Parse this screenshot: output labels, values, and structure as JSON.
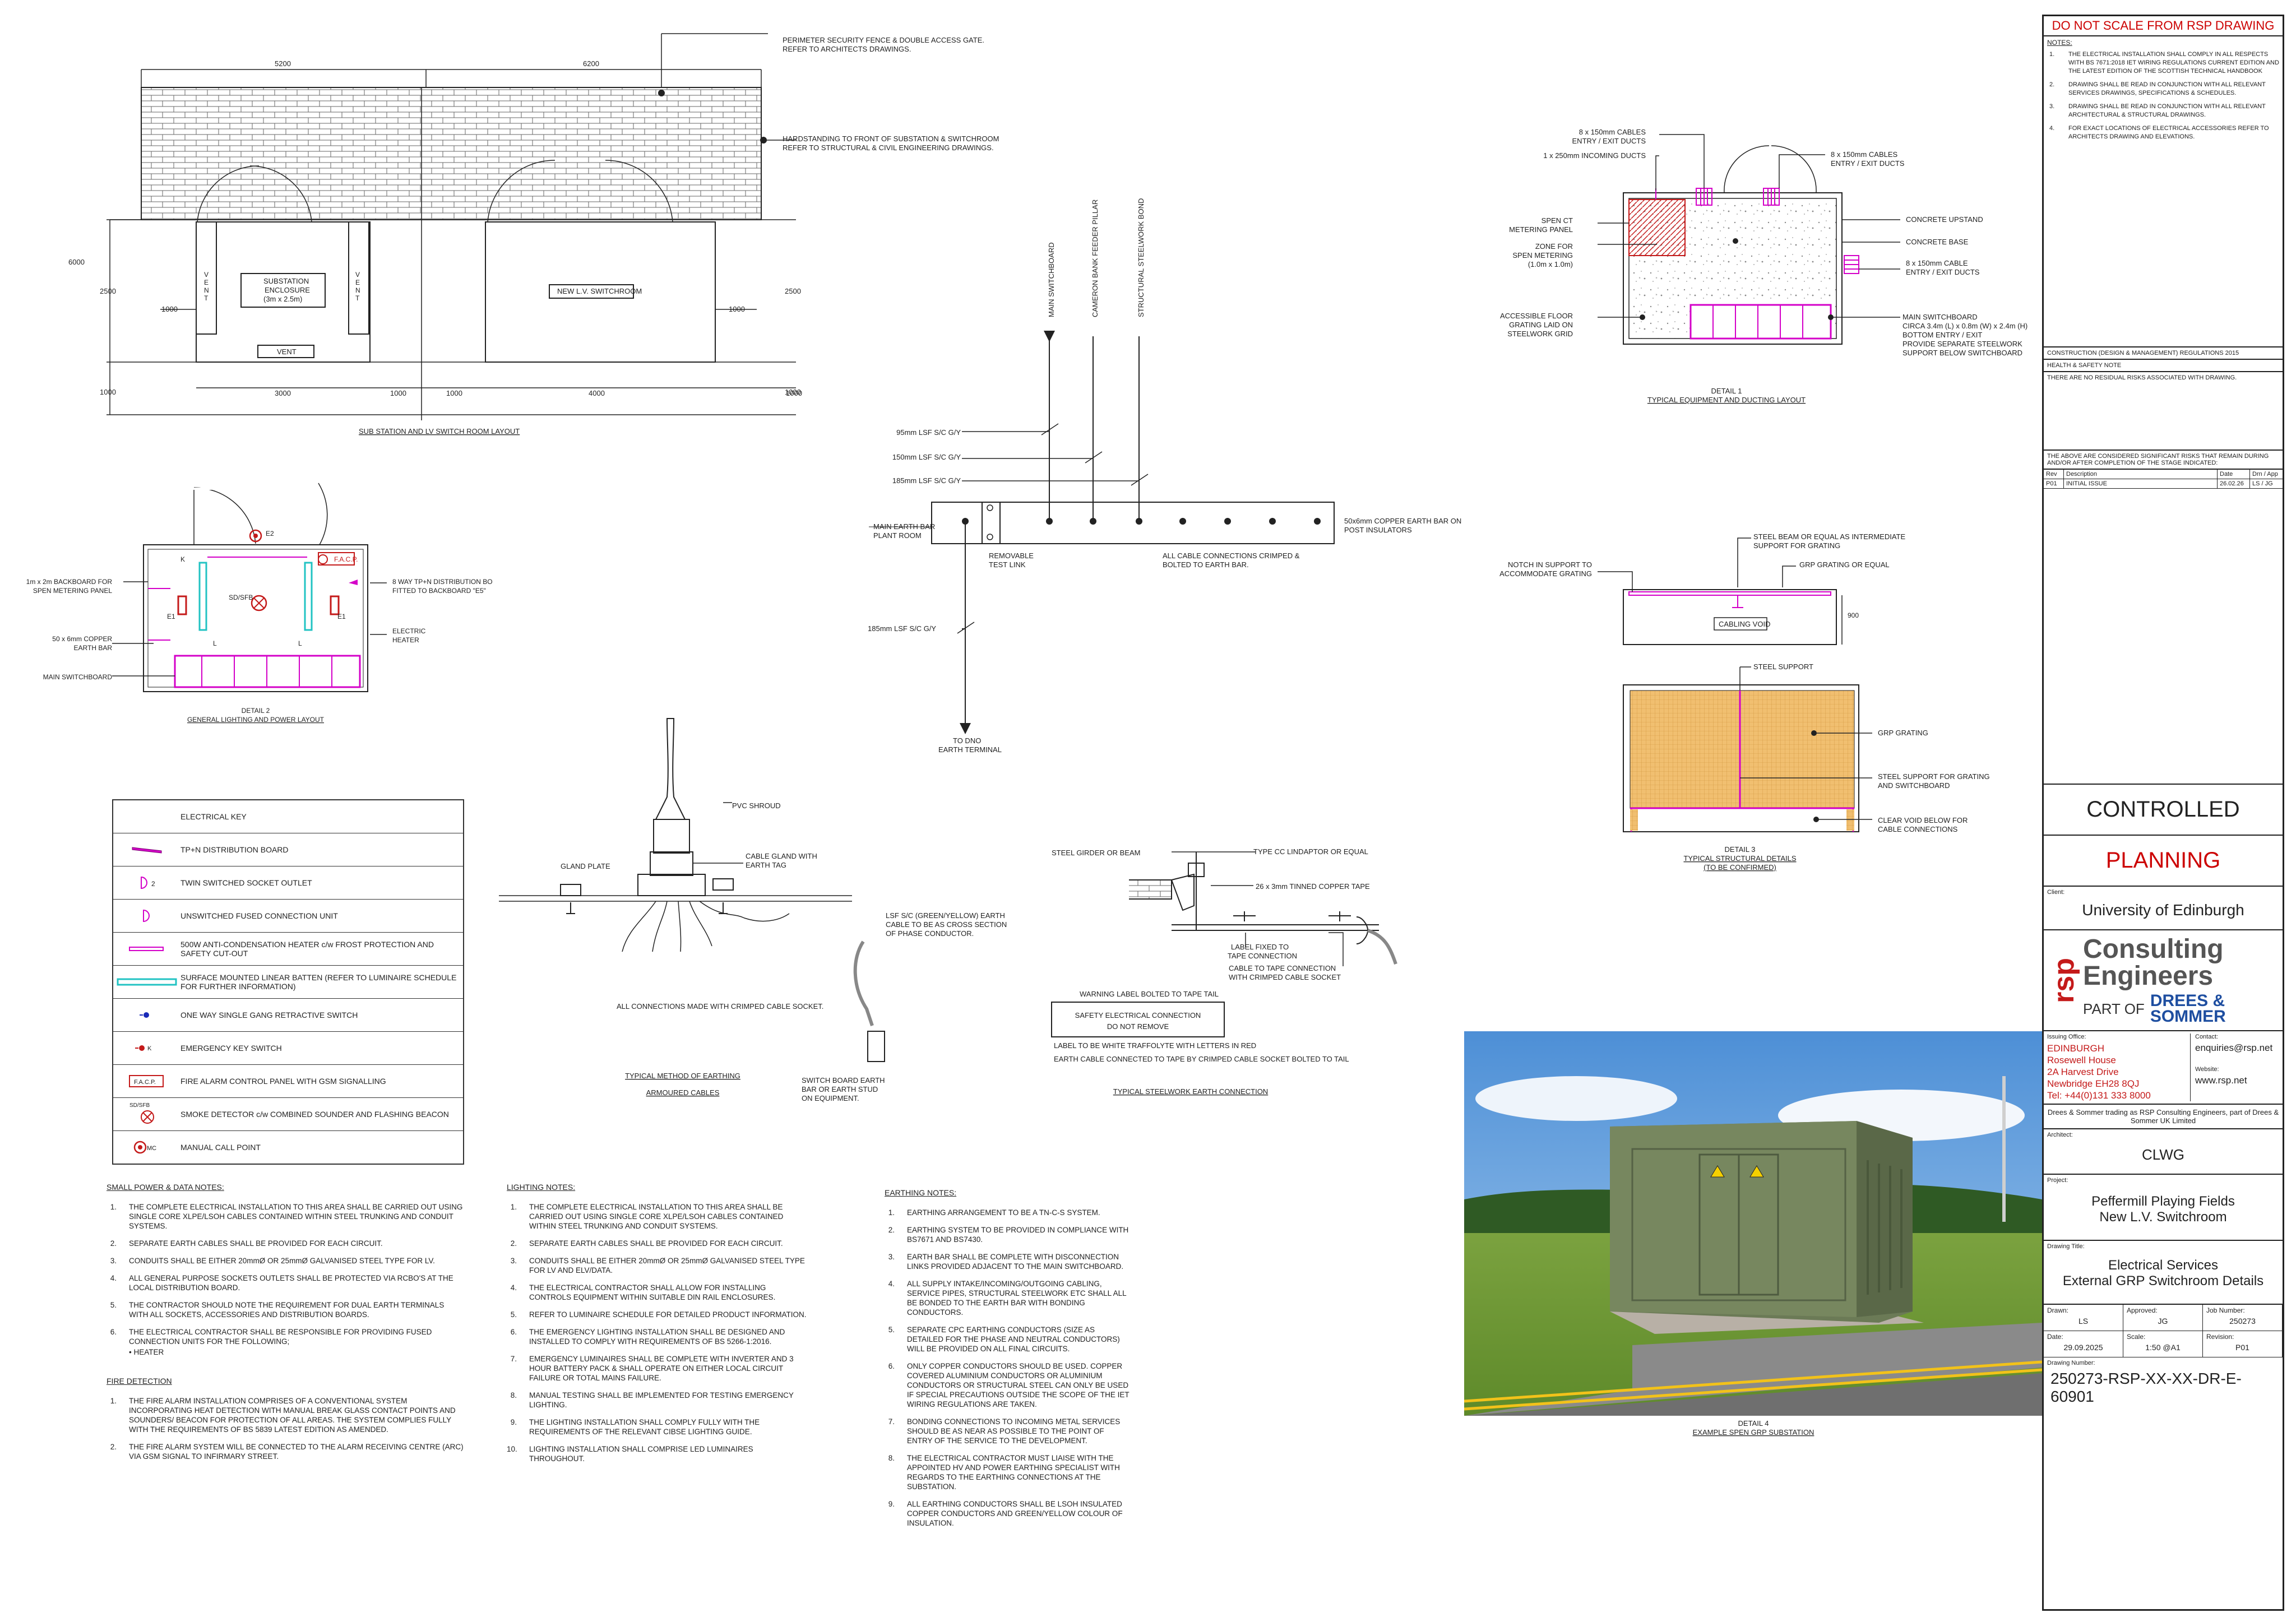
{
  "title_block": {
    "warning": "DO NOT SCALE FROM RSP DRAWING",
    "notes_label": "NOTES:",
    "notes": [
      {
        "n": "1.",
        "text": "THE ELECTRICAL INSTALLATION SHALL COMPLY IN ALL RESPECTS WITH BS 7671:2018 IET WIRING REGULATIONS CURRENT EDITION AND THE LATEST EDITION OF THE SCOTTISH TECHNICAL HANDBOOK"
      },
      {
        "n": "2.",
        "text": "DRAWING SHALL BE READ IN CONJUNCTION WITH ALL RELEVANT SERVICES DRAWINGS, SPECIFICATIONS & SCHEDULES."
      },
      {
        "n": "3.",
        "text": "DRAWING SHALL BE READ IN CONJUNCTION WITH ALL RELEVANT ARCHITECTURAL & STRUCTURAL DRAWINGS."
      },
      {
        "n": "4.",
        "text": "FOR EXACT LOCATIONS OF ELECTRICAL ACCESSORIES REFER TO ARCHITECTS DRAWING AND ELEVATIONS."
      }
    ],
    "cdm": "CONSTRUCTION (DESIGN & MANAGEMENT) REGULATIONS 2015",
    "hs_label": "HEALTH & SAFETY NOTE",
    "hs_text": "THERE ARE NO RESIDUAL RISKS ASSOCIATED WITH DRAWING.",
    "risks_text": "THE ABOVE ARE CONSIDERED SIGNIFICANT RISKS THAT REMAIN DURING AND/OR AFTER COMPLETION OF THE STAGE INDICATED:",
    "rev_headers": {
      "rev": "Rev",
      "desc": "Description",
      "date": "Date",
      "drn": "Drn / App"
    },
    "rev_row": {
      "rev": "P01",
      "desc": "INITIAL ISSUE",
      "date": "26.02.26",
      "drn": "LS / JG"
    },
    "status_1": "CONTROLLED",
    "status_2": "PLANNING",
    "client_label": "Client:",
    "client": "University of Edinburgh",
    "logo": {
      "rsp": "rsp",
      "line1": "Consulting",
      "line2": "Engineers",
      "part_of": "PART OF",
      "ds1": "DREES &",
      "ds2": "SOMMER"
    },
    "issuing_label": "Issuing Office:",
    "office": [
      "EDINBURGH",
      "Rosewell House",
      "2A Harvest Drive",
      "Newbridge EH28 8QJ",
      "Tel: +44(0)131 333 8000"
    ],
    "contact_label": "Contact:",
    "contact": "enquiries@rsp.net",
    "website_label": "Website:",
    "website": "www.rsp.net",
    "trading": "Drees & Sommer trading as RSP Consulting Engineers, part of Drees & Sommer UK Limited",
    "architect_label": "Architect:",
    "architect": "CLWG",
    "project_label": "Project:",
    "project_1": "Peffermill Playing Fields",
    "project_2": "New L.V. Switchroom",
    "drawing_title_label": "Drawing Title:",
    "drawing_title_1": "Electrical Services",
    "drawing_title_2": "External GRP Switchroom Details",
    "fields": [
      {
        "label": "Drawn:",
        "value": "LS"
      },
      {
        "label": "Approved:",
        "value": "JG"
      },
      {
        "label": "Job Number:",
        "value": "250273"
      },
      {
        "label": "Date:",
        "value": "29.09.2025"
      },
      {
        "label": "Scale:",
        "value": "1:50 @A1"
      },
      {
        "label": "Revision:",
        "value": "P01"
      }
    ],
    "drawing_number_label": "Drawing Number:",
    "drawing_number": "250273-RSP-XX-XX-DR-E-60901"
  },
  "layout_plan": {
    "dims": {
      "top_left": "5200",
      "top_right": "6200",
      "h_total": "6000",
      "h_mid_left": "2500",
      "h_mid_right": "2500",
      "h_bot_left": "1000",
      "h_bot_right": "1000",
      "w_1000a": "1000",
      "w_1000b": "1000",
      "b_3000": "3000",
      "b_1000a": "1000",
      "b_1000b": "1000",
      "b_4000": "4000",
      "b_1000c": "1000"
    },
    "fence_note_1": "PERIMETER SECURITY FENCE & DOUBLE ACCESS GATE.",
    "fence_note_2": "REFER TO ARCHITECTS DRAWINGS.",
    "hard_note_1": "HARDSTANDING TO FRONT OF SUBSTATION & SWITCHROOM",
    "hard_note_2": "REFER TO STRUCTURAL & CIVIL ENGINEERING DRAWINGS.",
    "substation": [
      "SUBSTATION",
      "ENCLOSURE",
      "(3m x 2.5m)"
    ],
    "vent": "VENT",
    "vent_v": [
      "V",
      "E",
      "N",
      "T"
    ],
    "switchroom": "NEW L.V. SWITCHROOM",
    "title": "SUB STATION AND LV SWITCH ROOM LAYOUT"
  },
  "earthing_schematic": {
    "vlabels": [
      "MAIN SWITCHBOARD",
      "CAMERON BANK FEEDER PILLAR",
      "STRUCTURAL STEELWORK BOND"
    ],
    "cables": [
      "95mm LSF S/C G/Y",
      "150mm LSF S/C G/Y",
      "185mm LSF S/C G/Y"
    ],
    "main_bar": [
      "MAIN EARTH BAR",
      "PLANT ROOM"
    ],
    "copper_bar": [
      "50x6mm COPPER EARTH BAR ON",
      "POST INSULATORS"
    ],
    "test_link": [
      "REMOVABLE",
      "TEST LINK"
    ],
    "crimped": [
      "ALL CABLE CONNECTIONS CRIMPED &",
      "BOLTED TO EARTH BAR."
    ],
    "dno_cable": "185mm LSF S/C G/Y",
    "dno": [
      "TO DNO",
      "EARTH TERMINAL"
    ]
  },
  "detail_1": {
    "labels": {
      "cables_in": [
        "8 x 150mm CABLES",
        "ENTRY / EXIT DUCTS"
      ],
      "incoming": "1 x 250mm INCOMING DUCTS",
      "cables_r": [
        "8 x 150mm CABLES",
        "ENTRY / EXIT DUCTS"
      ],
      "spen": [
        "SPEN CT",
        "METERING PANEL"
      ],
      "zone": [
        "ZONE FOR",
        "SPEN METERING",
        "(1.0m x 1.0m)"
      ],
      "upstand": "CONCRETE UPSTAND",
      "base": "CONCRETE BASE",
      "cable_side": [
        "8 x 150mm CABLE",
        "ENTRY / EXIT DUCTS"
      ],
      "floor": [
        "ACCESSIBLE FLOOR",
        "GRATING LAID ON",
        "STEELWORK GRID"
      ],
      "msb": [
        "MAIN SWITCHBOARD",
        "CIRCA 3.4m (L) x 0.8m (W) x 2.4m (H)",
        "BOTTOM ENTRY / EXIT",
        "PROVIDE SEPARATE STEELWORK",
        "SUPPORT BELOW SWITCHBOARD"
      ]
    },
    "title_1": "DETAIL 1",
    "title_2": "TYPICAL EQUIPMENT AND DUCTING LAYOUT"
  },
  "detail_2": {
    "labels": {
      "backboard": [
        "1m x 2m BACKBOARD FOR",
        "SPEN METERING PANEL"
      ],
      "copper": [
        "50 x 6mm COPPER",
        "EARTH BAR"
      ],
      "msb": "MAIN SWITCHBOARD",
      "db": [
        "8 WAY TP+N DISTRIBUTION BO",
        "FITTED TO BACKBOARD \"E5\""
      ],
      "heater": [
        "ELECTRIC",
        "HEATER"
      ],
      "sdsfb": "SD/SFB",
      "facp": "F.A.C.P.",
      "e1": "E1",
      "e2": "E2",
      "l": "L",
      "k": "K"
    },
    "title_1": "DETAIL 2",
    "title_2": "GENERAL LIGHTING AND POWER LAYOUT"
  },
  "detail_3": {
    "labels": {
      "notch": [
        "NOTCH IN SUPPORT TO",
        "ACCOMMODATE GRATING"
      ],
      "beam": [
        "STEEL BEAM OR EQUAL AS INTERMEDIATE",
        "SUPPORT FOR GRATING"
      ],
      "grp_eq": "GRP GRATING OR EQUAL",
      "void": "CABLING VOID",
      "dim": "900",
      "steel_support": "STEEL SUPPORT",
      "grp": "GRP GRATING",
      "support_sw": [
        "STEEL SUPPORT FOR GRATING",
        "AND SWITCHBOARD"
      ],
      "clear": [
        "CLEAR VOID BELOW FOR",
        "CABLE CONNECTIONS"
      ]
    },
    "title_1": "DETAIL 3",
    "title_2": "TYPICAL STRUCTURAL DETAILS",
    "title_3": "(TO BE CONFIRMED)"
  },
  "detail_4": {
    "title_1": "DETAIL 4",
    "title_2": "EXAMPLE SPEN GRP SUBSTATION"
  },
  "armoured": {
    "pvc": "PVC SHROUD",
    "gland_plate": "GLAND PLATE",
    "gland": [
      "CABLE GLAND WITH",
      "EARTH TAG"
    ],
    "all_conn": "ALL CONNECTIONS MADE WITH CRIMPED CABLE SOCKET.",
    "lsf": [
      "LSF S/C (GREEN/YELLOW) EARTH",
      "CABLE TO BE AS CROSS SECTION",
      "OF PHASE CONDUCTOR."
    ],
    "stud": [
      "SWITCH BOARD EARTH",
      "BAR OR EARTH STUD",
      "ON EQUIPMENT."
    ],
    "title_1": "TYPICAL METHOD OF EARTHING",
    "title_2": "ARMOURED CABLES"
  },
  "steelwork": {
    "girder": "STEEL GIRDER OR BEAM",
    "type_cc": "TYPE CC LINDAPTOR OR EQUAL",
    "tape": "26 x 3mm TINNED COPPER TAPE",
    "label_fixed": [
      "LABEL FIXED TO",
      "TAPE CONNECTION"
    ],
    "cable_tape": [
      "CABLE TO TAPE CONNECTION",
      "WITH CRIMPED CABLE SOCKET"
    ],
    "warning_label": "WARNING LABEL BOLTED TO TAPE TAIL",
    "safety": [
      "SAFETY ELECTRICAL CONNECTION",
      "DO NOT REMOVE"
    ],
    "white": "LABEL TO BE WHITE TRAFFOLYTE WITH LETTERS IN RED",
    "earth_cable": "EARTH CABLE CONNECTED TO TAPE BY CRIMPED CABLE SOCKET BOLTED TO TAIL",
    "title": "TYPICAL STEELWORK EARTH CONNECTION"
  },
  "key": {
    "title": "ELECTRICAL KEY",
    "rows": [
      {
        "icon": "distribution-board-icon",
        "text": "TP+N DISTRIBUTION BOARD"
      },
      {
        "icon": "twin-socket-icon",
        "text": "TWIN SWITCHED SOCKET OUTLET"
      },
      {
        "icon": "fused-unit-icon",
        "text": "UNSWITCHED FUSED CONNECTION UNIT"
      },
      {
        "icon": "heater-icon",
        "text": "500W ANTI-CONDENSATION HEATER c/w FROST PROTECTION AND SAFETY CUT-OUT"
      },
      {
        "icon": "linear-batten-icon",
        "text": "SURFACE MOUNTED LINEAR BATTEN (REFER TO LUMINAIRE SCHEDULE FOR FURTHER INFORMATION)"
      },
      {
        "icon": "retractive-switch-icon",
        "text": "ONE WAY SINGLE GANG RETRACTIVE SWITCH"
      },
      {
        "icon": "emergency-key-switch-icon",
        "text": "EMERGENCY KEY SWITCH"
      },
      {
        "icon": "facp-icon",
        "text": "FIRE ALARM CONTROL PANEL WITH GSM SIGNALLING"
      },
      {
        "icon": "smoke-detector-icon",
        "text": "SMOKE DETECTOR c/w COMBINED SOUNDER AND FLASHING BEACON"
      },
      {
        "icon": "call-point-icon",
        "text": "MANUAL CALL POINT"
      }
    ],
    "sym_labels": {
      "twin": "2",
      "k": "K",
      "facp": "F.A.C.P.",
      "sdsfb": "SD/SFB",
      "mc": "MC"
    }
  },
  "small_power_notes": {
    "title": "SMALL POWER & DATA NOTES:",
    "items": [
      {
        "n": "1.",
        "text": "THE COMPLETE ELECTRICAL INSTALLATION TO THIS AREA SHALL BE CARRIED OUT USING SINGLE CORE XLPE/LSOH CABLES CONTAINED WITHIN STEEL TRUNKING AND CONDUIT SYSTEMS."
      },
      {
        "n": "2.",
        "text": "SEPARATE EARTH CABLES SHALL BE PROVIDED FOR EACH CIRCUIT."
      },
      {
        "n": "3.",
        "text": "CONDUITS SHALL BE EITHER 20mmØ OR 25mmØ GALVANISED STEEL TYPE FOR LV."
      },
      {
        "n": "4.",
        "text": "ALL GENERAL PURPOSE SOCKETS OUTLETS SHALL BE PROTECTED VIA RCBO'S AT THE LOCAL DISTRIBUTION BOARD."
      },
      {
        "n": "5.",
        "text": "THE CONTRACTOR SHOULD NOTE THE REQUIREMENT FOR DUAL EARTH TERMINALS WITH ALL SOCKETS, ACCESSORIES AND DISTRIBUTION BOARDS."
      },
      {
        "n": "6.",
        "text": "THE ELECTRICAL CONTRACTOR SHALL BE RESPONSIBLE FOR PROVIDING FUSED CONNECTION UNITS FOR THE FOLLOWING;"
      }
    ],
    "bullet": "HEATER"
  },
  "fire_notes": {
    "title": "FIRE DETECTION",
    "items": [
      {
        "n": "1.",
        "text": "THE FIRE ALARM INSTALLATION COMPRISES OF A CONVENTIONAL SYSTEM INCORPORATING HEAT DETECTION WITH MANUAL BREAK GLASS CONTACT POINTS AND SOUNDERS/ BEACON FOR PROTECTION OF ALL AREAS. THE SYSTEM COMPLIES FULLY WITH THE REQUIREMENTS OF BS 5839 LATEST EDITION AS AMENDED."
      },
      {
        "n": "2.",
        "text": "THE FIRE ALARM SYSTEM WILL BE CONNECTED TO THE ALARM RECEIVING CENTRE (ARC) VIA GSM SIGNAL TO INFIRMARY STREET."
      }
    ]
  },
  "lighting_notes": {
    "title": "LIGHTING NOTES:",
    "items": [
      {
        "n": "1.",
        "text": "THE COMPLETE ELECTRICAL INSTALLATION TO THIS AREA SHALL BE CARRIED OUT USING SINGLE CORE XLPE/LSOH CABLES CONTAINED WITHIN STEEL TRUNKING AND CONDUIT SYSTEMS."
      },
      {
        "n": "2.",
        "text": "SEPARATE EARTH CABLES SHALL BE PROVIDED FOR EACH CIRCUIT."
      },
      {
        "n": "3.",
        "text": "CONDUITS SHALL BE EITHER 20mmØ OR 25mmØ GALVANISED STEEL TYPE FOR LV AND ELV/DATA."
      },
      {
        "n": "4.",
        "text": "THE ELECTRICAL CONTRACTOR SHALL ALLOW FOR INSTALLING CONTROLS EQUIPMENT WITHIN SUITABLE DIN RAIL ENCLOSURES."
      },
      {
        "n": "5.",
        "text": "REFER TO LUMINAIRE SCHEDULE FOR DETAILED PRODUCT INFORMATION."
      },
      {
        "n": "6.",
        "text": "THE EMERGENCY LIGHTING INSTALLATION SHALL BE DESIGNED AND INSTALLED TO COMPLY WITH REQUIREMENTS OF BS 5266-1:2016."
      },
      {
        "n": "7.",
        "text": "EMERGENCY LUMINAIRES SHALL BE COMPLETE WITH INVERTER AND 3 HOUR BATTERY PACK & SHALL OPERATE ON EITHER LOCAL CIRCUIT FAILURE OR TOTAL MAINS FAILURE."
      },
      {
        "n": "8.",
        "text": "MANUAL TESTING SHALL BE IMPLEMENTED FOR TESTING EMERGENCY LIGHTING."
      },
      {
        "n": "9.",
        "text": "THE LIGHTING INSTALLATION SHALL COMPLY FULLY WITH THE REQUIREMENTS OF THE RELEVANT CIBSE LIGHTING GUIDE."
      },
      {
        "n": "10.",
        "text": "LIGHTING INSTALLATION SHALL COMPRISE LED LUMINAIRES THROUGHOUT."
      }
    ]
  },
  "earthing_notes": {
    "title": "EARTHING NOTES:",
    "items": [
      {
        "n": "1.",
        "text": "EARTHING ARRANGEMENT TO BE A TN-C-S SYSTEM."
      },
      {
        "n": "2.",
        "text": "EARTHING SYSTEM TO BE PROVIDED IN COMPLIANCE WITH BS7671 AND BS7430."
      },
      {
        "n": "3.",
        "text": "EARTH BAR SHALL BE COMPLETE WITH DISCONNECTION LINKS PROVIDED ADJACENT TO THE MAIN SWITCHBOARD."
      },
      {
        "n": "4.",
        "text": "ALL SUPPLY INTAKE/INCOMING/OUTGOING CABLING, SERVICE PIPES, STRUCTURAL STEELWORK ETC SHALL ALL BE BONDED TO THE EARTH BAR WITH BONDING CONDUCTORS."
      },
      {
        "n": "5.",
        "text": "SEPARATE CPC EARTHING CONDUCTORS (SIZE AS DETAILED FOR THE PHASE AND NEUTRAL CONDUCTORS) WILL BE PROVIDED ON ALL FINAL CIRCUITS."
      },
      {
        "n": "6.",
        "text": "ONLY COPPER CONDUCTORS SHOULD BE USED. COPPER COVERED ALUMINIUM CONDUCTORS OR ALUMINIUM CONDUCTORS OR STRUCTURAL STEEL CAN ONLY BE USED IF SPECIAL PRECAUTIONS OUTSIDE THE SCOPE OF THE IET WIRING REGULATIONS ARE TAKEN."
      },
      {
        "n": "7.",
        "text": "BONDING CONNECTIONS TO INCOMING METAL SERVICES SHOULD BE AS NEAR AS POSSIBLE TO THE POINT OF ENTRY OF THE SERVICE TO THE DEVELOPMENT."
      },
      {
        "n": "8.",
        "text": "THE ELECTRICAL CONTRACTOR MUST LIAISE WITH THE APPOINTED HV AND POWER EARTHING SPECIALIST WITH REGARDS TO THE EARTHING CONNECTIONS AT THE SUBSTATION."
      },
      {
        "n": "9.",
        "text": "ALL EARTHING CONDUCTORS SHALL BE LSOH INSULATED COPPER CONDUCTORS AND GREEN/YELLOW COLOUR OF INSULATION."
      }
    ]
  },
  "colors": {
    "magenta": "#d400c8",
    "red": "#c41a1a",
    "cyan": "#22c3c3",
    "grating": "#f1bf70"
  }
}
